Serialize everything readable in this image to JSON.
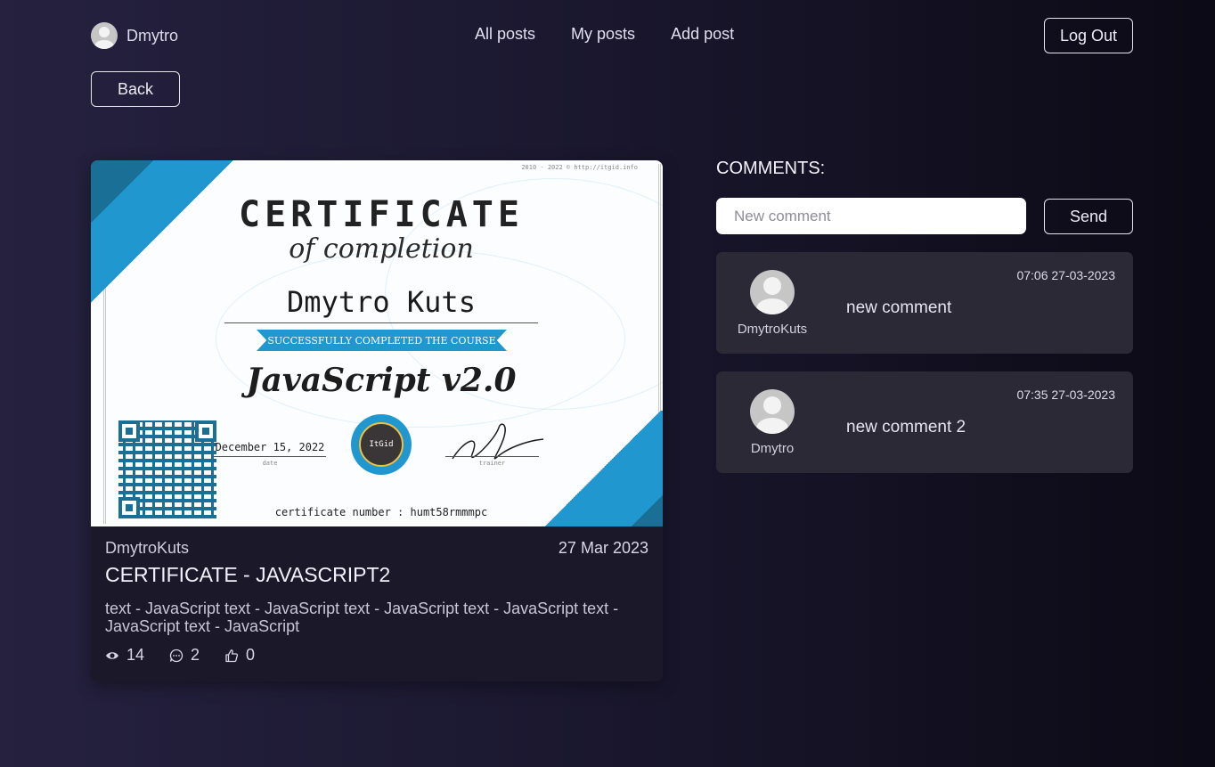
{
  "header": {
    "user_name": "Dmytro",
    "nav": [
      "All posts",
      "My posts",
      "Add post"
    ],
    "logout_label": "Log Out"
  },
  "back_label": "Back",
  "post": {
    "image": {
      "top_note": "2010 - 2022 © http://itgid.info",
      "title": "CERTIFICATE",
      "subtitle": "of completion",
      "name": "Dmytro Kuts",
      "ribbon": "SUCCESSFULLY COMPLETED THE COURSE",
      "course": "JavaScript v2.0",
      "date": "December 15, 2022",
      "date_label": "date",
      "seal": "ItGid",
      "trainer_label": "trainer",
      "number": "certificate number : humt58rmmmpc"
    },
    "author": "DmytroKuts",
    "date": "27 Mar 2023",
    "title": "CERTIFICATE - JAVASCRIPT2",
    "text": "text - JavaScript text - JavaScript text - JavaScript text - JavaScript text - JavaScript text - JavaScript",
    "views": "14",
    "comments": "2",
    "likes": "0"
  },
  "comments": {
    "title": "COMMENTS:",
    "input_placeholder": "New comment",
    "send_label": "Send",
    "items": [
      {
        "author": "DmytroKuts",
        "text": "new comment",
        "time": "07:06 27-03-2023"
      },
      {
        "author": "Dmytro",
        "text": "new comment 2",
        "time": "07:35 27-03-2023"
      }
    ]
  }
}
